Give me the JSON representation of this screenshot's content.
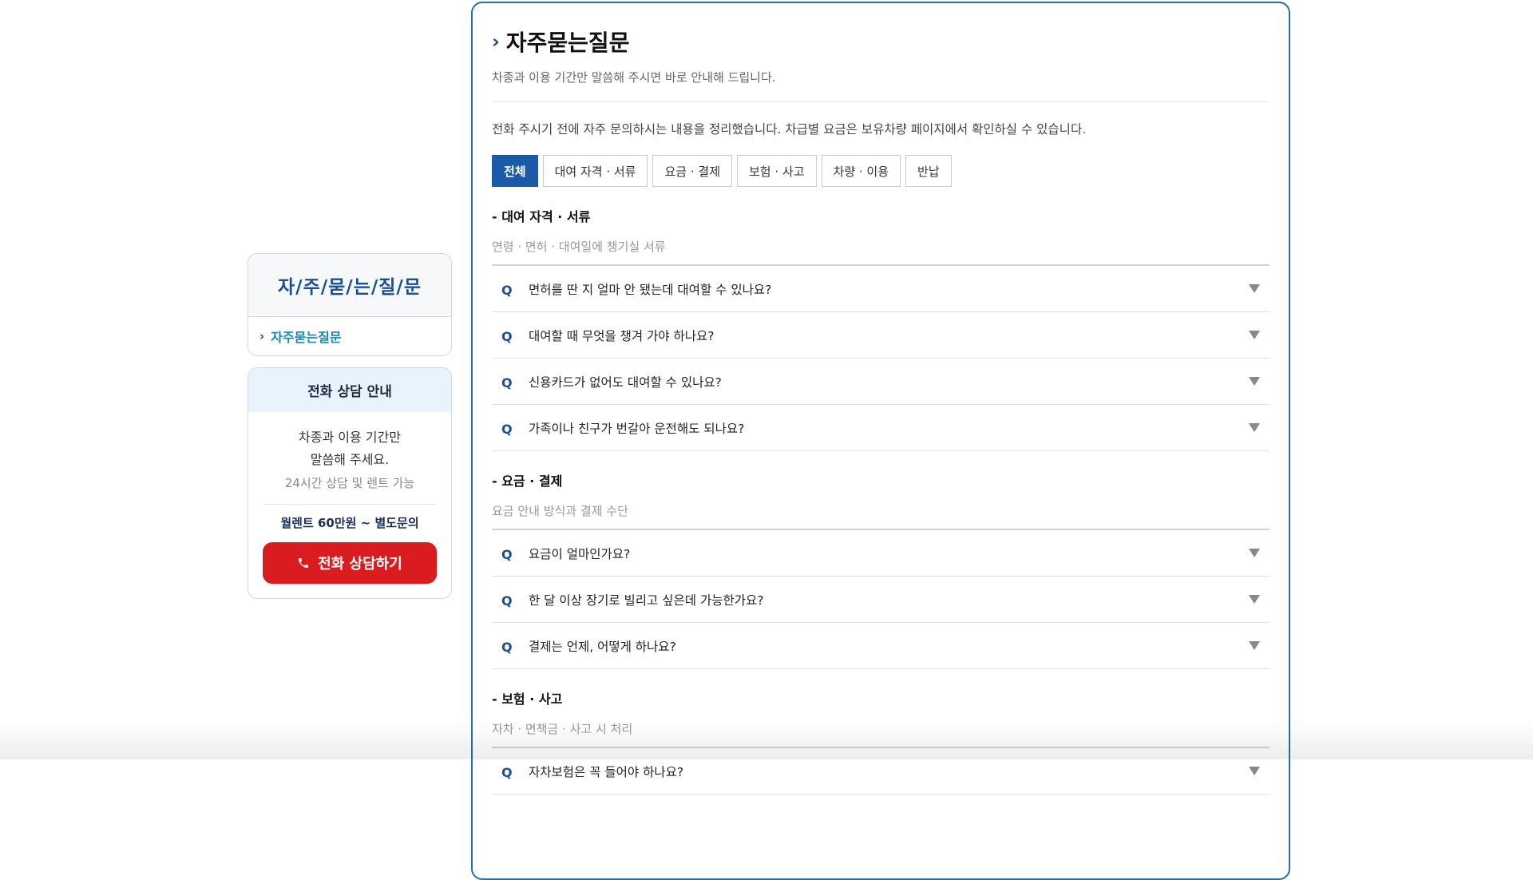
{
  "sidebar": {
    "title": "자/주/묻/는/질/문",
    "menu_item": "자주묻는질문",
    "contact": {
      "heading": "전화 상담 안내",
      "line1": "차종과 이용 기간만",
      "line2": "말씀해 주세요.",
      "sub": "24시간 상담 및 렌트 가능",
      "price": "월렌트 60만원 ~ 별도문의",
      "button": "전화 상담하기"
    }
  },
  "main": {
    "title": "자주묻는질문",
    "subtitle": "차종과 이용 기간만 말씀해 주시면 바로 안내해 드립니다.",
    "intro": "전화 주시기 전에 자주 문의하시는 내용을 정리했습니다. 차급별 요금은 보유차량 페이지에서 확인하실 수 있습니다.",
    "tabs": [
      "전체",
      "대여 자격 · 서류",
      "요금 · 결제",
      "보험 · 사고",
      "차량 · 이용",
      "반납"
    ],
    "active_tab": "전체",
    "q_marker": "Q",
    "sections": [
      {
        "title": "- 대여 자격 · 서류",
        "subtitle": "연령 · 면허 · 대여일에 챙기실 서류",
        "questions": [
          "면허를 딴 지 얼마 안 됐는데 대여할 수 있나요?",
          "대여할 때 무엇을 챙겨 가야 하나요?",
          "신용카드가 없어도 대여할 수 있나요?",
          "가족이나 친구가 번갈아 운전해도 되나요?"
        ]
      },
      {
        "title": "- 요금 · 결제",
        "subtitle": "요금 안내 방식과 결제 수단",
        "questions": [
          "요금이 얼마인가요?",
          "한 달 이상 장기로 빌리고 싶은데 가능한가요?",
          "결제는 언제, 어떻게 하나요?"
        ]
      },
      {
        "title": "- 보험 · 사고",
        "subtitle": "자차 · 면책금 · 사고 시 처리",
        "questions": [
          "자차보험은 꼭 들어야 하나요?"
        ]
      }
    ]
  },
  "colors": {
    "brand_blue": "#1b5aa8",
    "panel_border": "#2a6ea8",
    "call_red": "#d91c1f"
  },
  "icons": {
    "menu_chevron": "chevron-right-icon",
    "call": "phone-icon",
    "faq_toggle": "caret-down-icon"
  }
}
